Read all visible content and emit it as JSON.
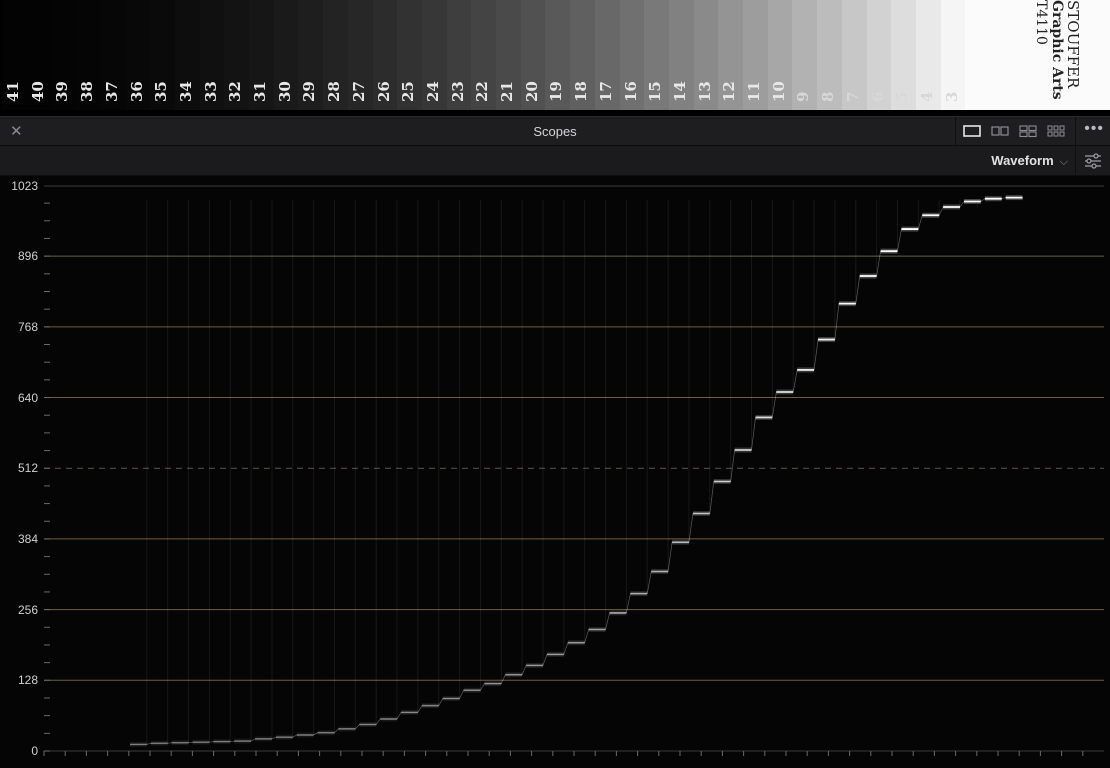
{
  "step_wedge": {
    "labels": [
      "41",
      "40",
      "39",
      "38",
      "37",
      "36",
      "35",
      "34",
      "33",
      "32",
      "31",
      "30",
      "29",
      "28",
      "27",
      "26",
      "25",
      "24",
      "23",
      "22",
      "21",
      "20",
      "19",
      "18",
      "17",
      "16",
      "15",
      "14",
      "13",
      "12",
      "11",
      "10",
      "9",
      "8",
      "7",
      "6",
      "5",
      "4",
      "3"
    ],
    "brand": [
      "STOUFFER",
      "Graphic Arts",
      "T4110"
    ]
  },
  "panel": {
    "title": "Scopes",
    "close_icon": "close-icon",
    "layout_icons": [
      "single-view-icon",
      "dual-view-icon",
      "quad-view-icon",
      "multi-view-icon"
    ],
    "more_icon": "more-options-icon"
  },
  "toolbar": {
    "scope_type": "Waveform",
    "dropdown_icon": "chevron-down-icon",
    "settings_icon": "sliders-icon"
  },
  "waveform": {
    "scale_labels": [
      "1023",
      "896",
      "768",
      "640",
      "512",
      "384",
      "256",
      "128",
      "0"
    ],
    "scale_values": [
      1023,
      896,
      768,
      640,
      512,
      384,
      256,
      128,
      0
    ],
    "ylim": [
      0,
      1023
    ],
    "midline": 512,
    "colors": {
      "graticule": "#7a6a44",
      "label": "#cfcfcf",
      "trace": "#ffffff"
    },
    "step_levels": [
      12,
      14,
      15,
      16,
      17,
      18,
      22,
      25,
      29,
      33,
      40,
      48,
      58,
      70,
      82,
      95,
      110,
      122,
      138,
      155,
      175,
      196,
      220,
      250,
      285,
      325,
      378,
      430,
      488,
      545,
      604,
      650,
      690,
      745,
      810,
      860,
      905,
      945,
      970,
      985,
      995,
      1000,
      1002
    ]
  }
}
